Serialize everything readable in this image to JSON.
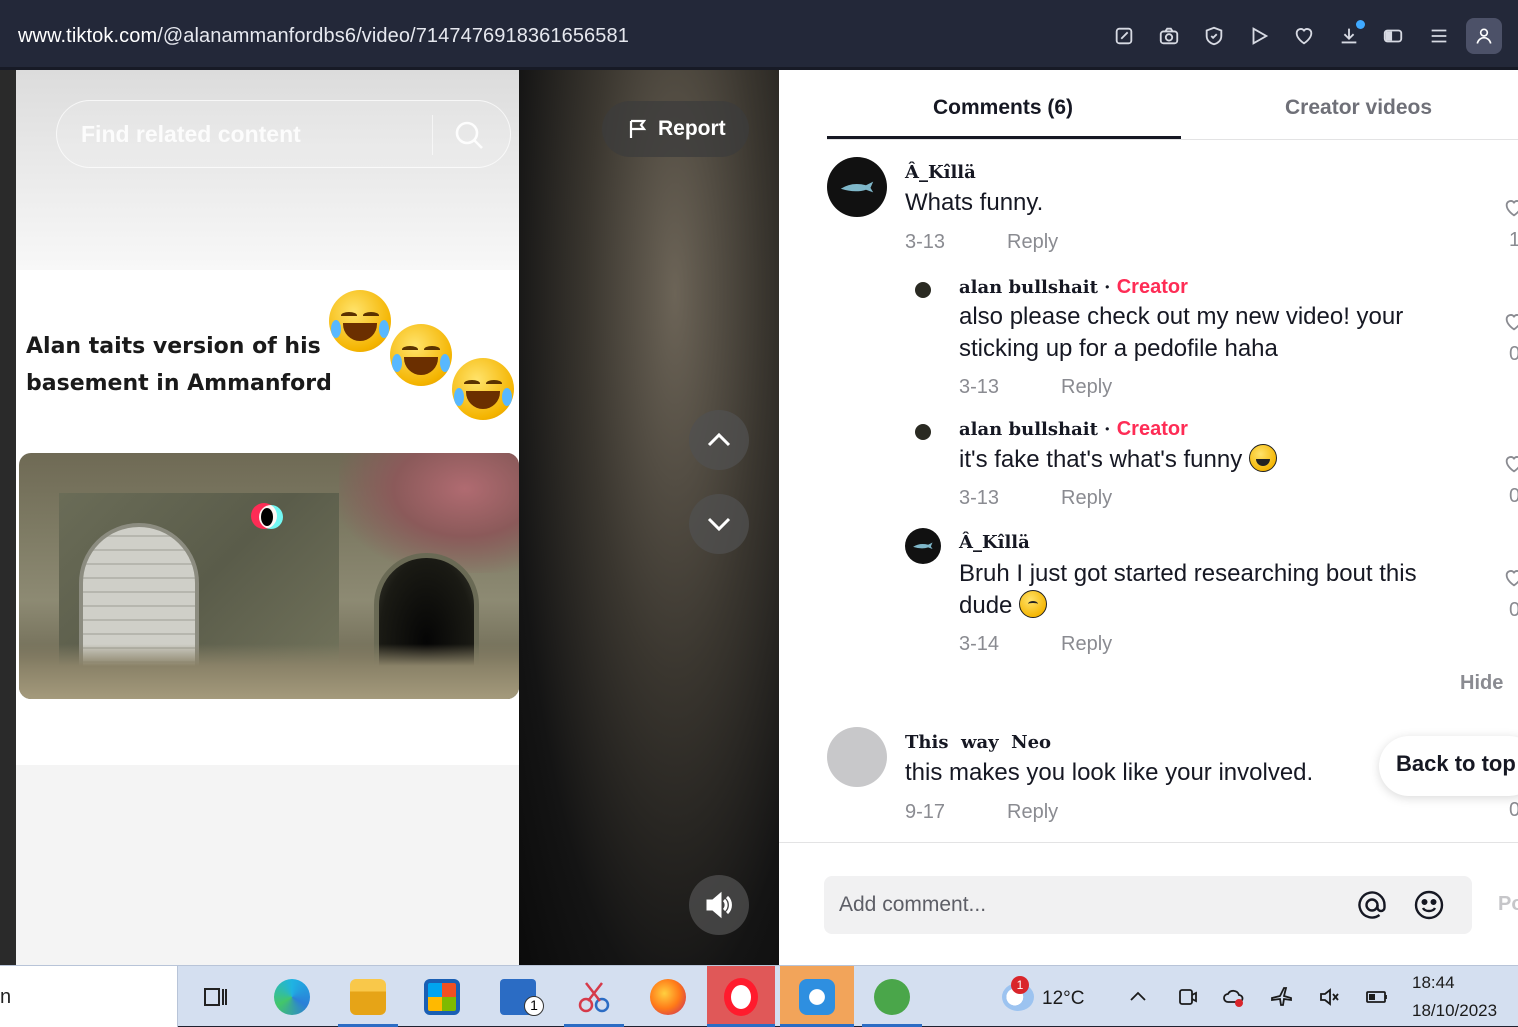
{
  "browser": {
    "url_host": "www.tiktok.com",
    "url_path": "/@alanammanfordbs6/video/7147476918361656581"
  },
  "video": {
    "search_placeholder": "Find related content",
    "report_label": "Report",
    "caption": "Alan taits version of his basement in Ammanford"
  },
  "comments_panel": {
    "tabs": [
      {
        "label": "Comments (6)",
        "active": true
      },
      {
        "label": "Creator videos",
        "active": false
      }
    ],
    "comments": [
      {
        "username": "Â_Kîllä",
        "text": "Whats funny.",
        "date": "3-13",
        "reply": "Reply",
        "likes": "1"
      },
      {
        "username": "alan bullshait",
        "badge": "Creator",
        "text": "also please check out my new video! your sticking up for a pedofile haha",
        "date": "3-13",
        "reply": "Reply",
        "likes": "0"
      },
      {
        "username": "alan bullshait",
        "badge": "Creator",
        "text": "it's fake that's what's funny",
        "date": "3-13",
        "reply": "Reply",
        "likes": "0"
      },
      {
        "username": "Â_Kîllä",
        "text": "Bruh I just got started researching bout this dude",
        "date": "3-14",
        "reply": "Reply",
        "likes": "0"
      },
      {
        "username": "This  way  Neo",
        "text": "this makes you look like your involved.",
        "date": "9-17",
        "reply": "Reply",
        "likes": "0"
      }
    ],
    "hide_label": "Hide",
    "back_to_top": "Back to top",
    "comment_placeholder": "Add comment...",
    "post_label": "Post"
  },
  "taskbar": {
    "search_text": "n",
    "weather_badge": "1",
    "mail_badge": "1",
    "temperature": "12°C",
    "time": "18:44",
    "date": "18/10/2023"
  },
  "colors": {
    "accent_creator": "#fe2c55",
    "browser_bar": "#232839"
  }
}
